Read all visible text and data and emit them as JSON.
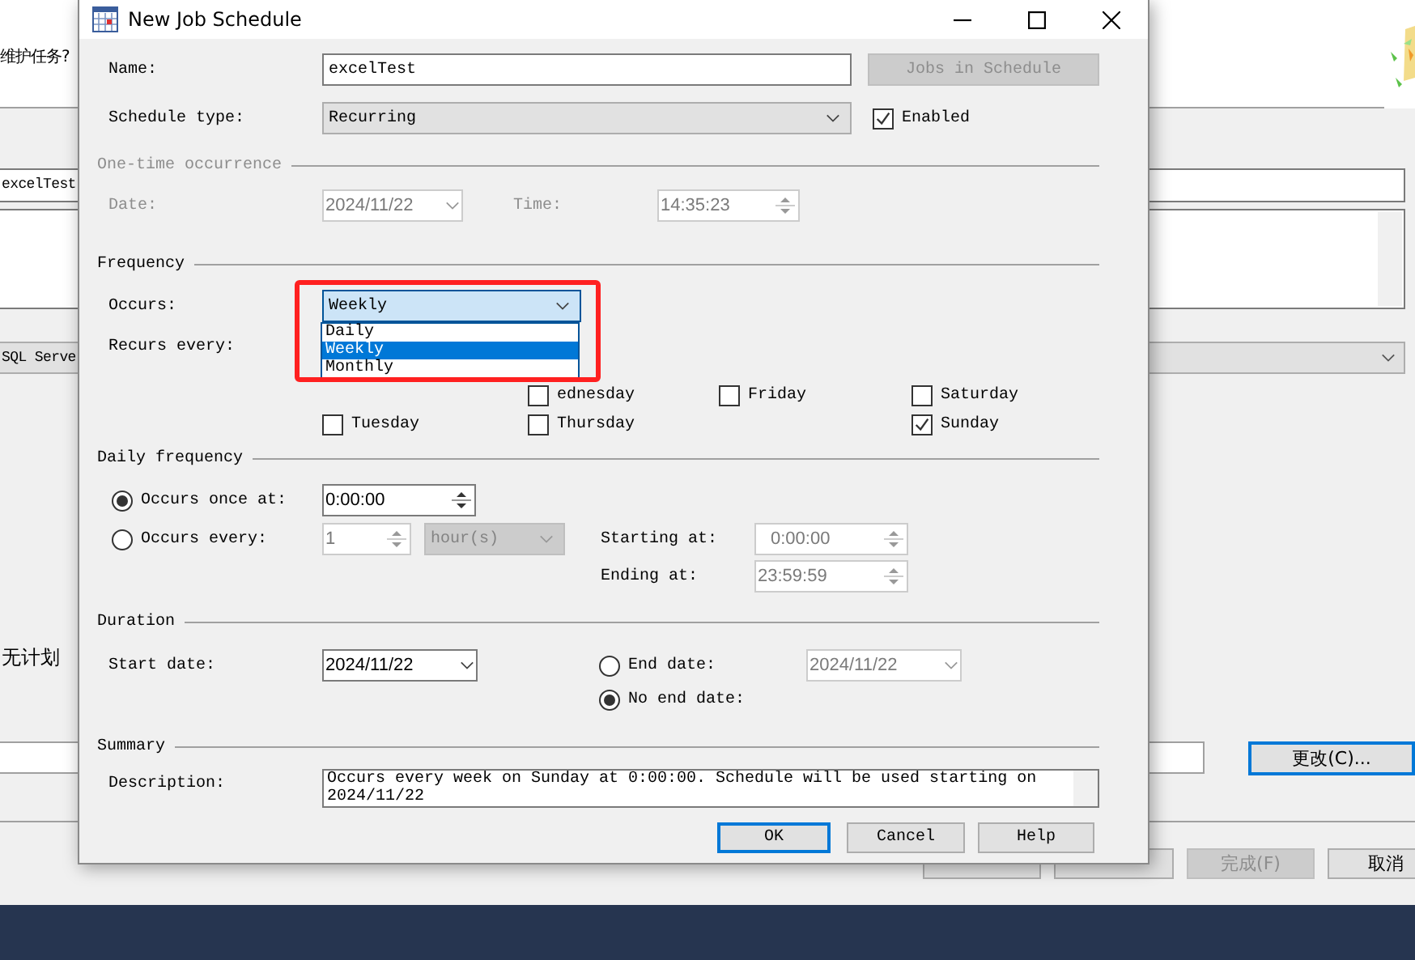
{
  "background_window": {
    "prompt": "维护任务?",
    "name_value": "excelTest",
    "server_value": "SQL Serve",
    "schedule_status": "无计划",
    "change_button": "更改(C)...",
    "buttons": [
      {
        "label": "完成(F)",
        "disabled": true
      },
      {
        "label": "取消",
        "disabled": false
      }
    ]
  },
  "dialog": {
    "title": "New Job Schedule",
    "name": {
      "label": "Name:",
      "value": "excelTest"
    },
    "jobs_button": {
      "label": "Jobs in Schedule",
      "disabled": true
    },
    "schedule_type": {
      "label": "Schedule type:",
      "value": "Recurring"
    },
    "enabled": {
      "label": "Enabled",
      "checked": true
    },
    "one_time": {
      "title": "One-time occurrence",
      "disabled": true,
      "date_label": "Date:",
      "date": "2024/11/22",
      "time_label": "Time:",
      "time": "14:35:23"
    },
    "frequency": {
      "title": "Frequency",
      "occurs_label": "Occurs:",
      "occurs_value": "Weekly",
      "dropdown": [
        {
          "label": "Daily",
          "selected": false
        },
        {
          "label": "Weekly",
          "selected": true
        },
        {
          "label": "Monthly",
          "selected": false
        }
      ],
      "recurs_label": "Recurs every:",
      "days": [
        {
          "label": "ednesday",
          "checked": false
        },
        {
          "label": "Friday",
          "checked": false
        },
        {
          "label": "Saturday",
          "checked": false
        },
        {
          "label": "Tuesday",
          "checked": false
        },
        {
          "label": "Thursday",
          "checked": false
        },
        {
          "label": "Sunday",
          "checked": true
        }
      ]
    },
    "daily_frequency": {
      "title": "Daily frequency",
      "options": [
        {
          "label": "Occurs once at:",
          "selected": true,
          "value": "0:00:00"
        },
        {
          "label": "Occurs every:",
          "selected": false,
          "value": "1",
          "unit": "hour(s)"
        }
      ],
      "starting_label": "Starting at:",
      "starting": "0:00:00",
      "ending_label": "Ending at:",
      "ending": "23:59:59"
    },
    "duration": {
      "title": "Duration",
      "start_label": "Start date:",
      "start": "2024/11/22",
      "end_options": [
        {
          "label": "End date:",
          "selected": false,
          "value": "2024/11/22"
        },
        {
          "label": "No end date:",
          "selected": true
        }
      ]
    },
    "summary": {
      "title": "Summary",
      "description_label": "Description:",
      "description": "Occurs every week on Sunday at 0:00:00. Schedule will be used starting on 2024/11/22"
    },
    "buttons": [
      {
        "label": "OK",
        "default": true
      },
      {
        "label": "Cancel",
        "default": false
      },
      {
        "label": "Help",
        "default": false
      }
    ]
  }
}
